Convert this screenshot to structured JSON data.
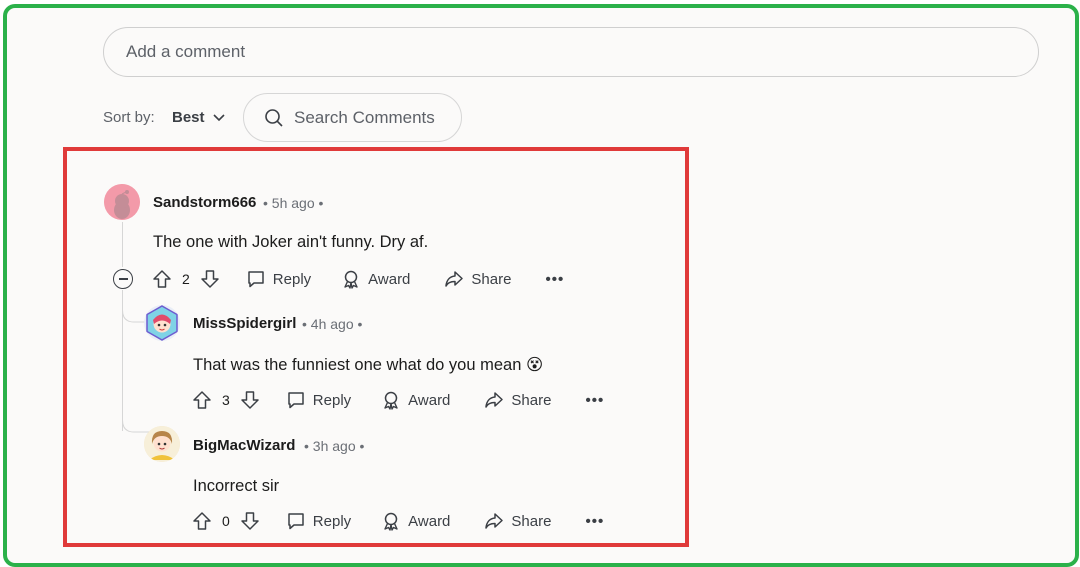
{
  "comment_input": {
    "placeholder": "Add a comment"
  },
  "sort": {
    "label": "Sort by:",
    "value": "Best"
  },
  "search": {
    "placeholder": "Search Comments"
  },
  "comments": [
    {
      "author": "Sandstorm666",
      "time": "5h ago",
      "text": "The one with Joker ain't funny. Dry af.",
      "votes": "2",
      "reply": "Reply",
      "award": "Award",
      "share": "Share",
      "more": "•••"
    },
    {
      "author": "MissSpidergirl",
      "time": "4h ago",
      "text": "That was the funniest one what do you mean 😵",
      "votes": "3",
      "reply": "Reply",
      "award": "Award",
      "share": "Share",
      "more": "•••"
    },
    {
      "author": "BigMacWizard",
      "time": "3h ago",
      "text": "Incorrect sir",
      "votes": "0",
      "reply": "Reply",
      "award": "Award",
      "share": "Share",
      "more": "•••"
    }
  ],
  "colors": {
    "frame": "#2bb14a",
    "highlight": "#e03a3a"
  }
}
